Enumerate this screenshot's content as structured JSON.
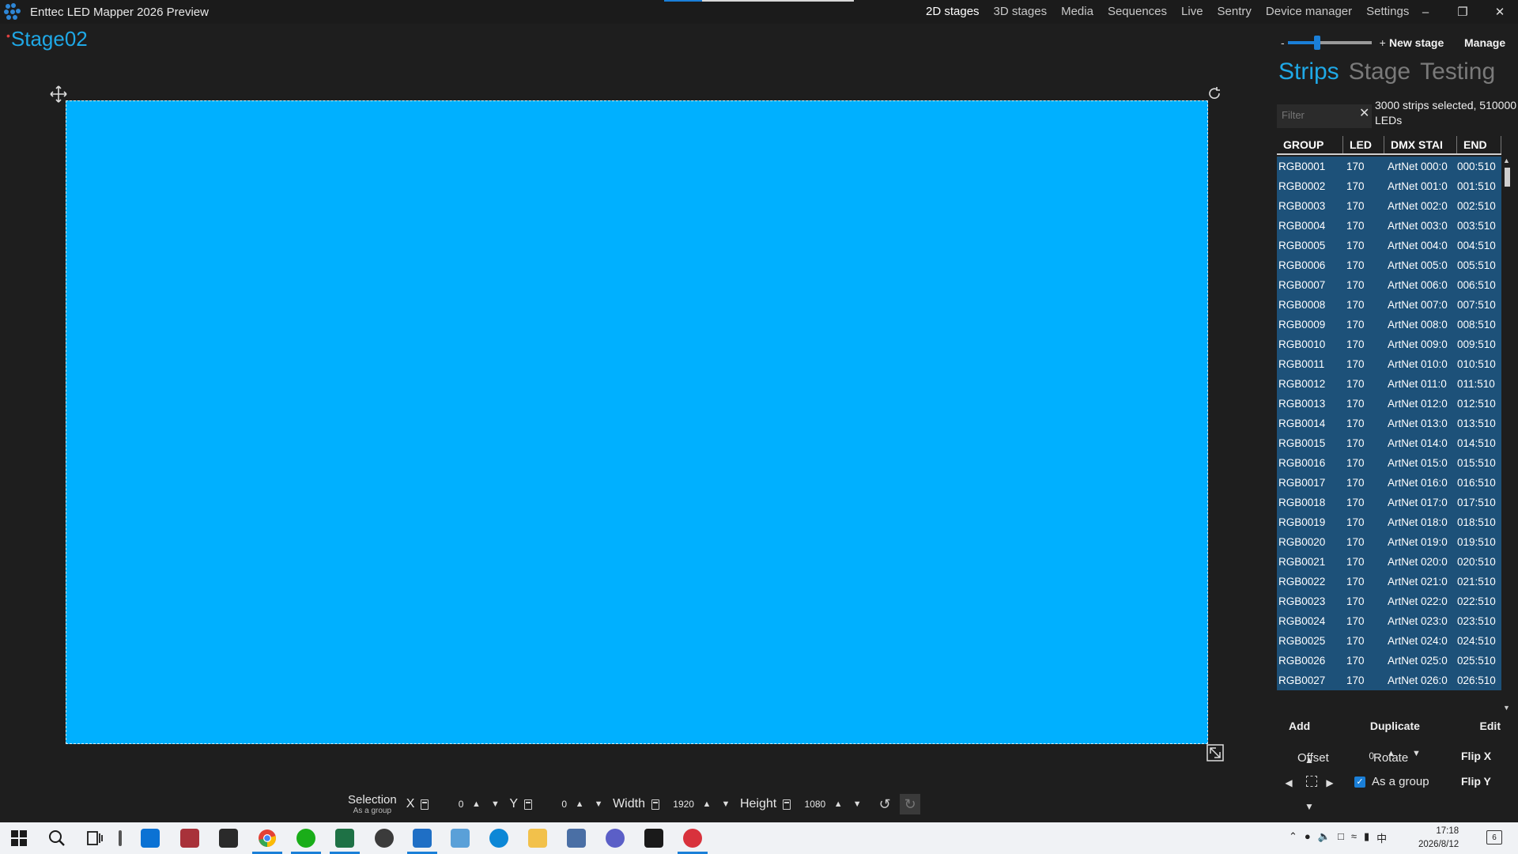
{
  "window": {
    "title": "Enttec LED Mapper 2026 Preview",
    "minimize_icon": "minimize-icon",
    "restore_icon": "restore-icon",
    "close_icon": "close-icon"
  },
  "nav": {
    "items": [
      "2D stages",
      "3D stages",
      "Media",
      "Sequences",
      "Live",
      "Sentry",
      "Device manager",
      "Settings"
    ],
    "active": "2D stages"
  },
  "stage": {
    "name": "Stage02",
    "canvas_color": "#00b0ff"
  },
  "toolbar": {
    "selection_label": "Selection",
    "selection_sub": "As a group",
    "x_label": "X",
    "x_value": "0",
    "y_label": "Y",
    "y_value": "0",
    "width_label": "Width",
    "width_value": "1920",
    "height_label": "Height",
    "height_value": "1080"
  },
  "panel": {
    "zoom_minus": "-",
    "zoom_plus": "+",
    "zoom_level": 0.35,
    "new_stage_label": "New stage",
    "manage_label": "Manage",
    "tabs": [
      "Strips",
      "Stage",
      "Testing"
    ],
    "active_tab": "Strips",
    "filter_placeholder": "Filter",
    "selection_info": "3000 strips selected, 510000 LEDs",
    "columns": [
      "GROUP",
      "LED",
      "DMX STAI",
      "END"
    ],
    "rows": [
      [
        "RGB0001",
        "170",
        "ArtNet 000:0",
        "000:510"
      ],
      [
        "RGB0002",
        "170",
        "ArtNet 001:0",
        "001:510"
      ],
      [
        "RGB0003",
        "170",
        "ArtNet 002:0",
        "002:510"
      ],
      [
        "RGB0004",
        "170",
        "ArtNet 003:0",
        "003:510"
      ],
      [
        "RGB0005",
        "170",
        "ArtNet 004:0",
        "004:510"
      ],
      [
        "RGB0006",
        "170",
        "ArtNet 005:0",
        "005:510"
      ],
      [
        "RGB0007",
        "170",
        "ArtNet 006:0",
        "006:510"
      ],
      [
        "RGB0008",
        "170",
        "ArtNet 007:0",
        "007:510"
      ],
      [
        "RGB0009",
        "170",
        "ArtNet 008:0",
        "008:510"
      ],
      [
        "RGB0010",
        "170",
        "ArtNet 009:0",
        "009:510"
      ],
      [
        "RGB0011",
        "170",
        "ArtNet 010:0",
        "010:510"
      ],
      [
        "RGB0012",
        "170",
        "ArtNet 011:0",
        "011:510"
      ],
      [
        "RGB0013",
        "170",
        "ArtNet 012:0",
        "012:510"
      ],
      [
        "RGB0014",
        "170",
        "ArtNet 013:0",
        "013:510"
      ],
      [
        "RGB0015",
        "170",
        "ArtNet 014:0",
        "014:510"
      ],
      [
        "RGB0016",
        "170",
        "ArtNet 015:0",
        "015:510"
      ],
      [
        "RGB0017",
        "170",
        "ArtNet 016:0",
        "016:510"
      ],
      [
        "RGB0018",
        "170",
        "ArtNet 017:0",
        "017:510"
      ],
      [
        "RGB0019",
        "170",
        "ArtNet 018:0",
        "018:510"
      ],
      [
        "RGB0020",
        "170",
        "ArtNet 019:0",
        "019:510"
      ],
      [
        "RGB0021",
        "170",
        "ArtNet 020:0",
        "020:510"
      ],
      [
        "RGB0022",
        "170",
        "ArtNet 021:0",
        "021:510"
      ],
      [
        "RGB0023",
        "170",
        "ArtNet 022:0",
        "022:510"
      ],
      [
        "RGB0024",
        "170",
        "ArtNet 023:0",
        "023:510"
      ],
      [
        "RGB0025",
        "170",
        "ArtNet 024:0",
        "024:510"
      ],
      [
        "RGB0026",
        "170",
        "ArtNet 025:0",
        "025:510"
      ],
      [
        "RGB0027",
        "170",
        "ArtNet 026:0",
        "026:510"
      ]
    ],
    "add_label": "Add",
    "duplicate_label": "Duplicate",
    "edit_label": "Edit",
    "offset_label": "Offset",
    "rotate_label": "Rotate",
    "rotate_value": "0",
    "flip_x_label": "Flip X",
    "flip_y_label": "Flip Y",
    "as_group_label": "As a group",
    "as_group_checked": true
  },
  "taskbar": {
    "apps": [
      "start-icon",
      "search-icon",
      "task-view-icon",
      "files-icon",
      "winrar-icon",
      "notes-icon",
      "chrome-icon",
      "wechat-icon",
      "excel-icon",
      "network-icon",
      "outlook-icon",
      "remote-desktop-icon",
      "edge-icon",
      "explorer-icon",
      "calculator-icon",
      "teams-icon",
      "pdf-icon",
      "led-mapper-icon"
    ],
    "ime": "中",
    "time": "17:18",
    "date": "2026/8/12",
    "notification_count": "6"
  }
}
